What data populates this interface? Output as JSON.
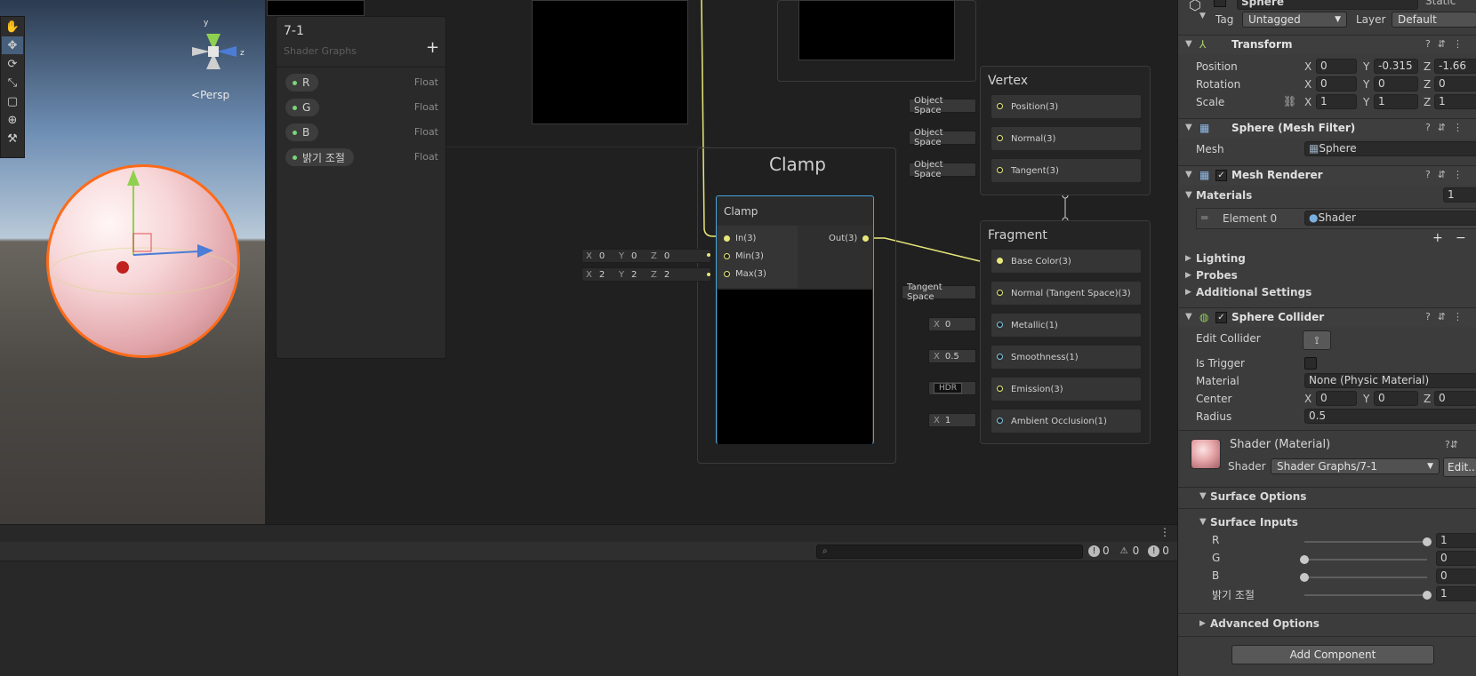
{
  "scene": {
    "persp_label": "Persp",
    "gizmo_axes": {
      "y": "y",
      "z": "z"
    }
  },
  "blackboard": {
    "title": "7-1",
    "subtitle": "Shader Graphs",
    "add_label": "+",
    "properties": [
      {
        "name": "R",
        "type": "Float"
      },
      {
        "name": "G",
        "type": "Float"
      },
      {
        "name": "B",
        "type": "Float"
      },
      {
        "name": "밝기 조절",
        "type": "Float"
      }
    ]
  },
  "clamp": {
    "group_title": "Clamp",
    "node_title": "Clamp",
    "in_label": "In(3)",
    "min_label": "Min(3)",
    "max_label": "Max(3)",
    "out_label": "Out(3)",
    "min": {
      "x": "0",
      "y": "0",
      "z": "0"
    },
    "max": {
      "x": "2",
      "y": "2",
      "z": "2"
    },
    "axis_x": "X",
    "axis_y": "Y",
    "axis_z": "Z"
  },
  "vertex": {
    "title": "Vertex",
    "slots": [
      {
        "label": "Position(3)",
        "input": "Object Space"
      },
      {
        "label": "Normal(3)",
        "input": "Object Space"
      },
      {
        "label": "Tangent(3)",
        "input": "Object Space"
      }
    ]
  },
  "fragment": {
    "title": "Fragment",
    "slots": [
      {
        "label": "Base Color(3)",
        "input": ""
      },
      {
        "label": "Normal (Tangent Space)(3)",
        "input": "Tangent Space"
      },
      {
        "label": "Metallic(1)",
        "input_axis": "X",
        "input": "0"
      },
      {
        "label": "Smoothness(1)",
        "input_axis": "X",
        "input": "0.5"
      },
      {
        "label": "Emission(3)",
        "input": "HDR"
      },
      {
        "label": "Ambient Occlusion(1)",
        "input_axis": "X",
        "input": "1"
      }
    ]
  },
  "console": {
    "counts": {
      "info": "0",
      "warn": "0",
      "error": "0"
    }
  },
  "inspector": {
    "object_name": "Sphere",
    "static_label": "Static",
    "tag_label": "Tag",
    "tag_value": "Untagged",
    "layer_label": "Layer",
    "layer_value": "Default",
    "transform": {
      "title": "Transform",
      "position_label": "Position",
      "position": {
        "x": "0",
        "y": "-0.315",
        "z": "-1.66"
      },
      "rotation_label": "Rotation",
      "rotation": {
        "x": "0",
        "y": "0",
        "z": "0"
      },
      "scale_label": "Scale",
      "scale": {
        "x": "1",
        "y": "1",
        "z": "1"
      }
    },
    "mesh_filter": {
      "title": "Sphere (Mesh Filter)",
      "mesh_label": "Mesh",
      "mesh_value": "Sphere"
    },
    "mesh_renderer": {
      "title": "Mesh Renderer",
      "materials_label": "Materials",
      "materials_count": "1",
      "element_label": "Element 0",
      "element_value": "Shader",
      "lighting": "Lighting",
      "probes": "Probes",
      "additional": "Additional Settings",
      "add_label": "+",
      "remove_label": "−"
    },
    "sphere_collider": {
      "title": "Sphere Collider",
      "edit_collider_label": "Edit Collider",
      "is_trigger_label": "Is Trigger",
      "material_label": "Material",
      "material_value": "None (Physic Material)",
      "center_label": "Center",
      "center": {
        "x": "0",
        "y": "0",
        "z": "0"
      },
      "radius_label": "Radius",
      "radius_value": "0.5"
    },
    "material": {
      "title": "Shader (Material)",
      "shader_label": "Shader",
      "shader_value": "Shader Graphs/7-1",
      "edit_label": "Edit..."
    },
    "surface_options": "Surface Options",
    "surface_inputs": {
      "title": "Surface Inputs",
      "sliders": [
        {
          "label": "R",
          "value": "1",
          "fraction": 1
        },
        {
          "label": "G",
          "value": "0",
          "fraction": 0
        },
        {
          "label": "B",
          "value": "0",
          "fraction": 0
        },
        {
          "label": "밝기 조절",
          "value": "1",
          "fraction": 1
        }
      ]
    },
    "advanced_options": "Advanced Options",
    "add_component": "Add Component",
    "axis_x": "X",
    "axis_y": "Y",
    "axis_z": "Z"
  },
  "colors": {
    "accent_blue": "#4aa3d8",
    "wire": "#e8e87a",
    "selection_orange": "#ff6a18"
  }
}
